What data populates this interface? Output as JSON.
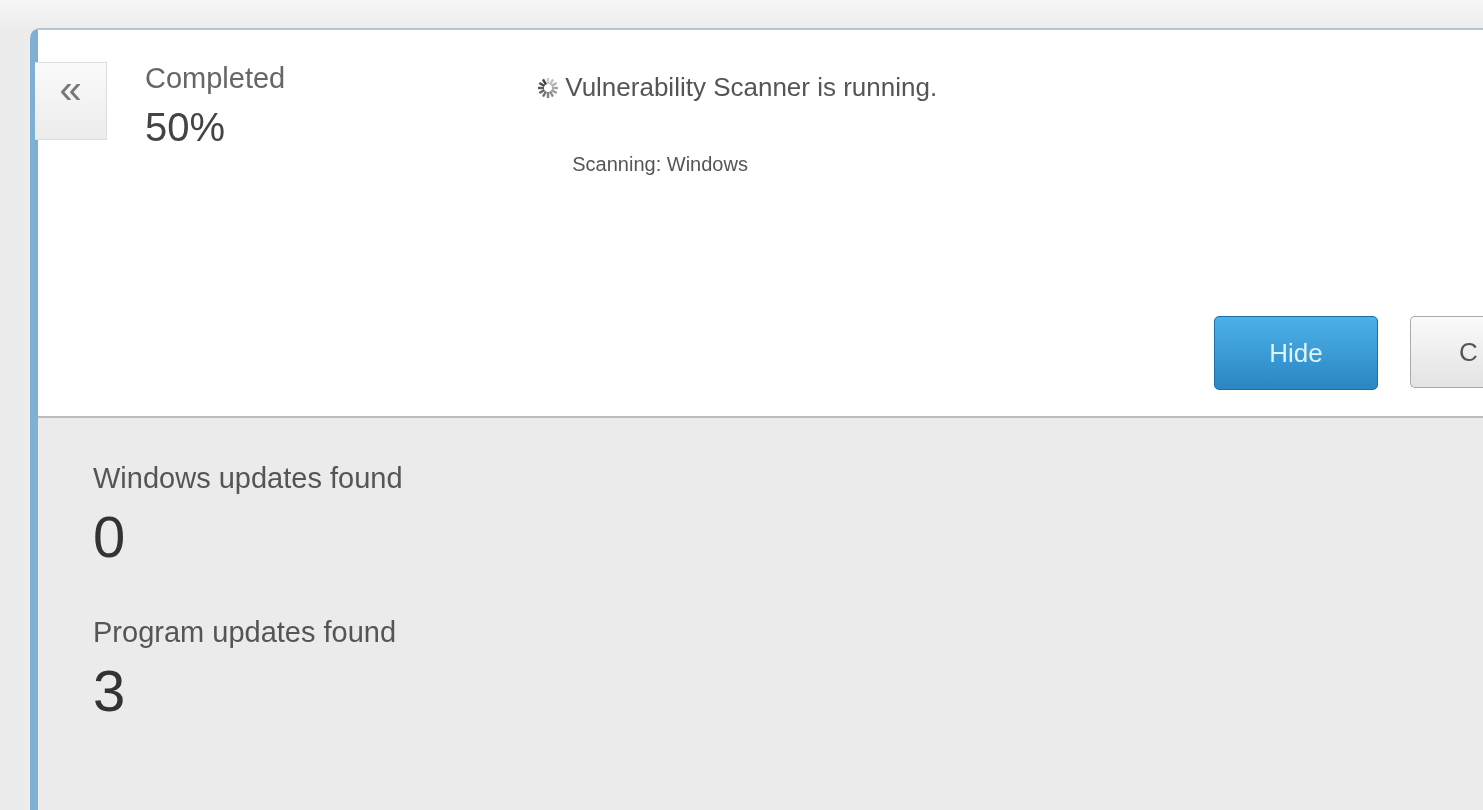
{
  "collapse_button": {
    "label": "«"
  },
  "progress": {
    "label": "Completed",
    "value": "50%"
  },
  "status": {
    "running": true,
    "message": "Vulnerability Scanner is running.",
    "detail": "Scanning: Windows"
  },
  "buttons": [
    {
      "label": "Hide",
      "kind": "primary"
    },
    {
      "label": "C",
      "kind": "secondary"
    }
  ],
  "results": [
    {
      "label": "Windows updates found",
      "count": "0"
    },
    {
      "label": "Program updates found",
      "count": "3"
    }
  ]
}
